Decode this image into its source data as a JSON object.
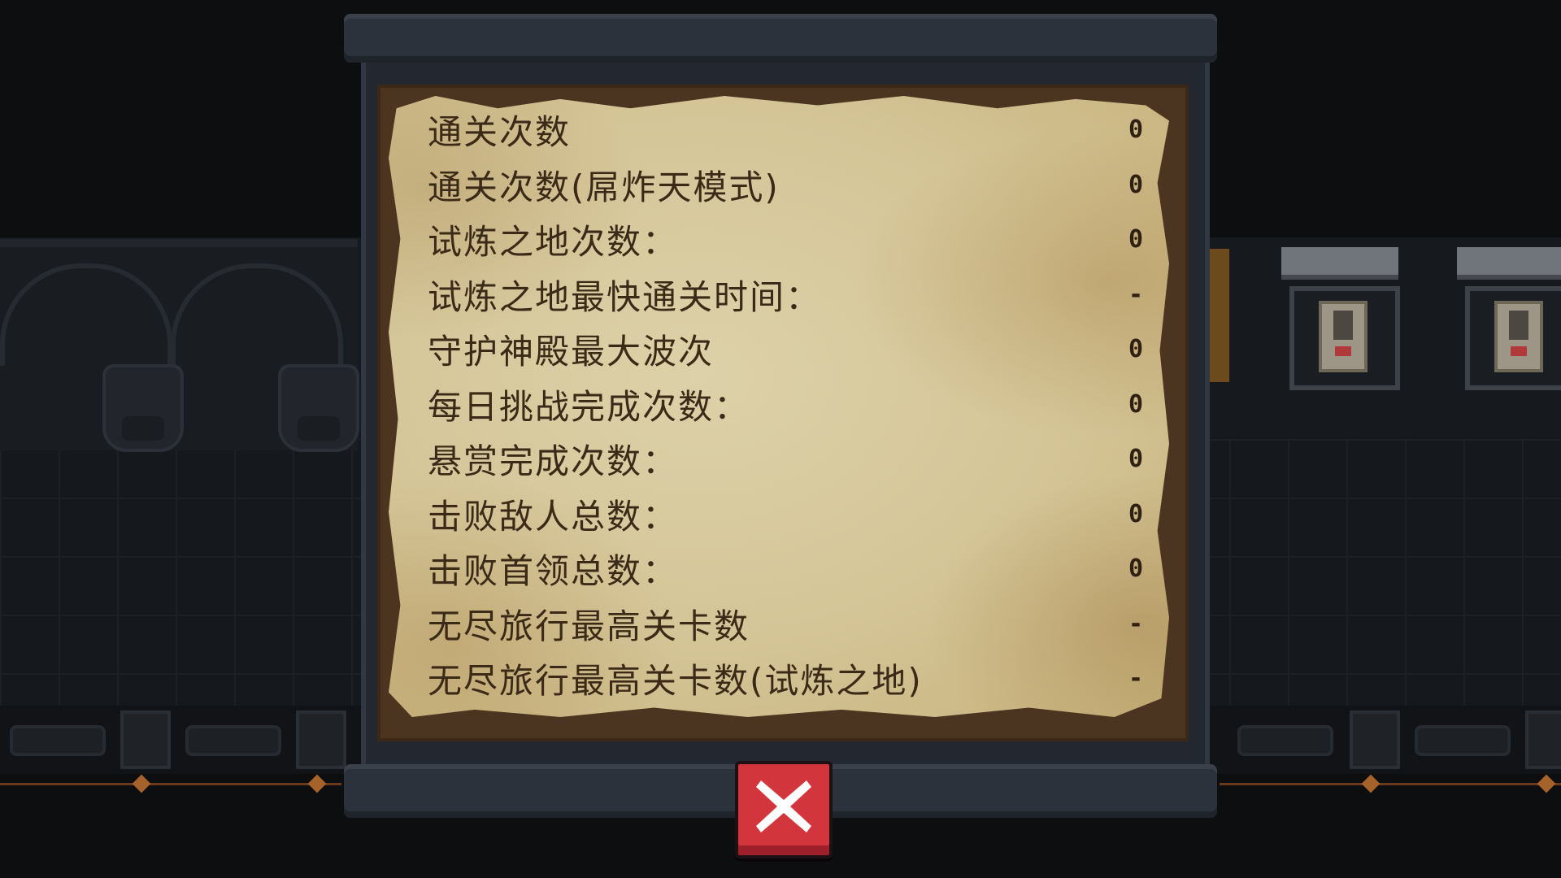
{
  "stats_panel": {
    "rows": [
      {
        "label": "通关次数",
        "value": "0"
      },
      {
        "label": "通关次数(屌炸天模式)",
        "value": "0"
      },
      {
        "label": "试炼之地次数：",
        "value": "0"
      },
      {
        "label": "试炼之地最快通关时间：",
        "value": "-"
      },
      {
        "label": "守护神殿最大波次",
        "value": "0"
      },
      {
        "label": "每日挑战完成次数：",
        "value": "0"
      },
      {
        "label": "悬赏完成次数：",
        "value": "0"
      },
      {
        "label": "击败敌人总数：",
        "value": "0"
      },
      {
        "label": "击败首领总数：",
        "value": "0"
      },
      {
        "label": "无尽旅行最高关卡数",
        "value": "-"
      },
      {
        "label": "无尽旅行最高关卡数(试炼之地)",
        "value": "-"
      }
    ]
  },
  "close_button": {
    "icon": "close-x-icon",
    "color": "#d3353d"
  },
  "colors": {
    "parchment": "#d4c597",
    "text": "#3b2a17",
    "scroll_frame": "#2c323b"
  }
}
